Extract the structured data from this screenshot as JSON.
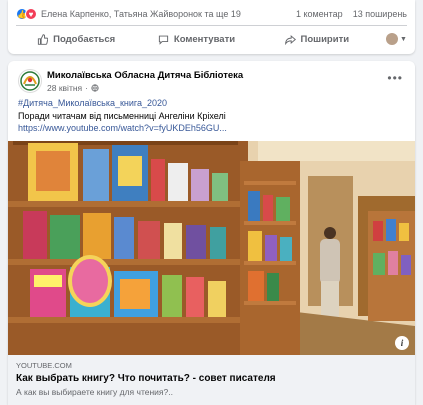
{
  "top_card": {
    "reacted_by": "Елена Карпенко, Татьяна Жайворонок та ще 19",
    "comments_count": "1 коментар",
    "shares_count": "13 поширень",
    "actions": {
      "like": "Подобається",
      "comment": "Коментувати",
      "share": "Поширити"
    }
  },
  "post": {
    "page_name": "Миколаївська Обласна Дитяча Бібліотека",
    "date": "28 квітня",
    "hashtag": "#Дитяча_Миколаївська_книга_2020",
    "text": "Поради читачам від письменниці Ангеліни Кріхелі",
    "link": "https://www.youtube.com/watch?v=fyUKDEh56GU...",
    "preview": {
      "domain": "YOUTUBE.COM",
      "title": "Как выбрать книгу? Что почитать? - совет писателя",
      "description": "А как вы выбираете книгу для чтения?..",
      "info": "i"
    }
  },
  "colors": {
    "like_blue": "#1877f2",
    "love_red": "#f33e58",
    "link_blue": "#385898"
  }
}
